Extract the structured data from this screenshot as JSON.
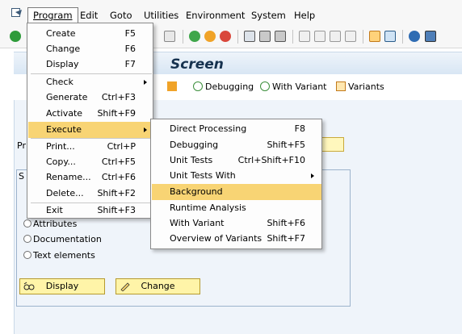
{
  "menubar": {
    "items": [
      {
        "label": "Program",
        "active": true
      },
      {
        "label": "Edit"
      },
      {
        "label": "Goto"
      },
      {
        "label": "Utilities"
      },
      {
        "label": "Environment"
      },
      {
        "label": "System"
      },
      {
        "label": "Help"
      }
    ]
  },
  "title": {
    "text": "Screen"
  },
  "app_toolbar": {
    "debugging_label": "Debugging",
    "with_variant_label": "With Variant",
    "variants_label": "Variants"
  },
  "main": {
    "program_label": "Pr",
    "subgroup_label": "S",
    "radios": [
      "Attributes",
      "Documentation",
      "Text elements"
    ],
    "display_button": "Display",
    "change_button": "Change"
  },
  "program_menu": {
    "items": [
      {
        "label": "Create",
        "shortcut": "F5"
      },
      {
        "label": "Change",
        "shortcut": "F6"
      },
      {
        "label": "Display",
        "shortcut": "F7"
      },
      {
        "label": "Check",
        "shortcut": ""
      },
      {
        "label": "Generate",
        "shortcut": "Ctrl+F3"
      },
      {
        "label": "Activate",
        "shortcut": "Shift+F9"
      },
      {
        "label": "Execute",
        "shortcut": ""
      },
      {
        "label": "Print...",
        "shortcut": "Ctrl+P"
      },
      {
        "label": "Copy...",
        "shortcut": "Ctrl+F5"
      },
      {
        "label": "Rename...",
        "shortcut": "Ctrl+F6"
      },
      {
        "label": "Delete...",
        "shortcut": "Shift+F2"
      },
      {
        "label": "Exit",
        "shortcut": "Shift+F3"
      }
    ]
  },
  "execute_submenu": {
    "items": [
      {
        "label": "Direct Processing",
        "shortcut": "F8"
      },
      {
        "label": "Debugging",
        "shortcut": "Shift+F5"
      },
      {
        "label": "Unit Tests",
        "shortcut": "Ctrl+Shift+F10"
      },
      {
        "label": "Unit Tests With",
        "shortcut": ""
      },
      {
        "label": "Background",
        "shortcut": ""
      },
      {
        "label": "Runtime Analysis",
        "shortcut": ""
      },
      {
        "label": "With Variant",
        "shortcut": "Shift+F6"
      },
      {
        "label": "Overview of Variants",
        "shortcut": "Shift+F7"
      }
    ]
  },
  "colors": {
    "menu_highlight": "#f8d474",
    "button_yellow": "#fff4a8",
    "work_area": "#eff4fa"
  }
}
